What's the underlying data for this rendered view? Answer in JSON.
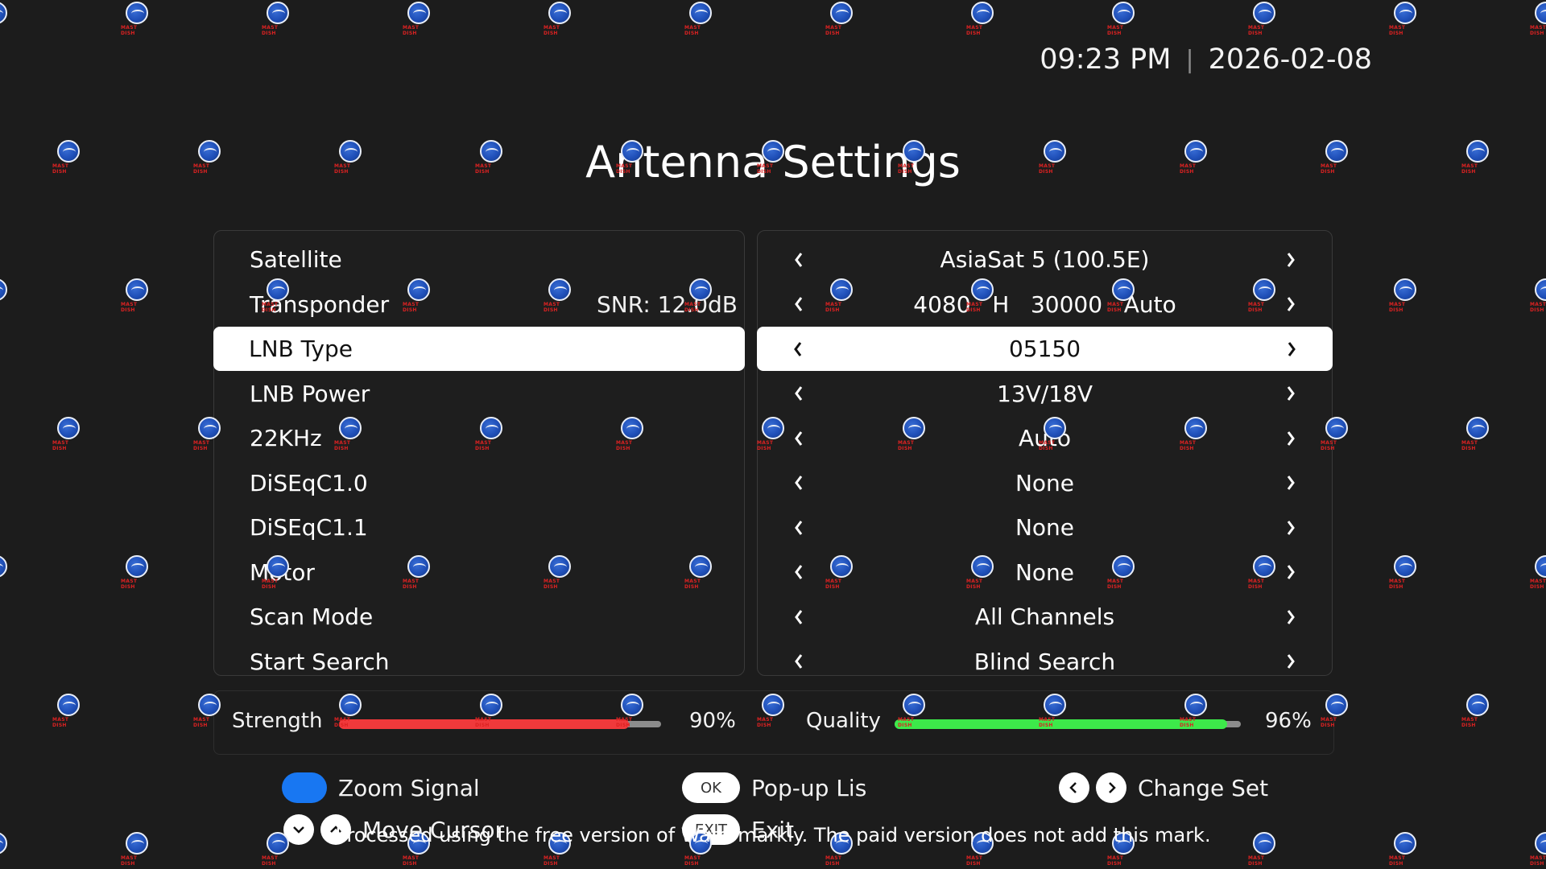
{
  "header": {
    "time": "09:23 PM",
    "separator": "|",
    "date": "2026-02-08"
  },
  "title": "Antenna Settings",
  "settings": [
    {
      "label": "Satellite",
      "value": "AsiaSat 5 (100.5E)",
      "extra": ""
    },
    {
      "label": "Transponder",
      "value": "4080   H   30000   Auto",
      "extra": "SNR: 12.0dB"
    },
    {
      "label": "LNB Type",
      "value": "05150",
      "extra": "",
      "selected": true
    },
    {
      "label": "LNB Power",
      "value": "13V/18V",
      "extra": ""
    },
    {
      "label": "22KHz",
      "value": "Auto",
      "extra": ""
    },
    {
      "label": "DiSEqC1.0",
      "value": "None",
      "extra": ""
    },
    {
      "label": "DiSEqC1.1",
      "value": "None",
      "extra": ""
    },
    {
      "label": "Motor",
      "value": "None",
      "extra": ""
    },
    {
      "label": "Scan Mode",
      "value": "All Channels",
      "extra": ""
    },
    {
      "label": "Start Search",
      "value": "Blind Search",
      "extra": ""
    }
  ],
  "signal": {
    "strength_label": "Strength",
    "strength_pct": "90%",
    "strength_value": 0.9,
    "strength_color": "#f0393b",
    "quality_label": "Quality",
    "quality_pct": "96%",
    "quality_value": 0.96,
    "quality_color": "#3de94a"
  },
  "legend": {
    "zoom_signal": "Zoom Signal",
    "ok_key": "OK",
    "popup_list": "Pop-up Lis",
    "change_set": "Change Set",
    "move_cursor": "Move Cursor",
    "exit_key": "EXIT",
    "exit": "Exit"
  },
  "watermark": {
    "brand": "MAST DISH",
    "notice": "Processed using the free version of Watermarkly. The paid version does not add this mark."
  },
  "colors": {
    "background": "#1c1c1c",
    "accent_blue": "#1877f2",
    "selected_bg": "#ffffff"
  }
}
